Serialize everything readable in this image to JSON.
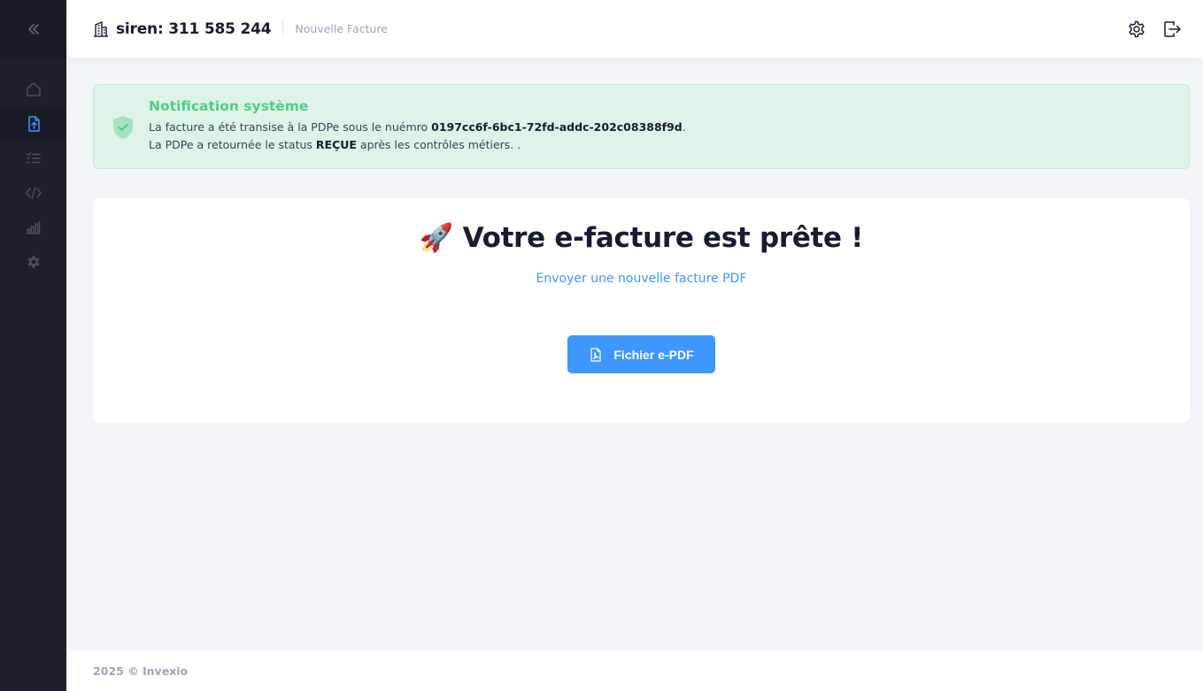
{
  "header": {
    "title": "siren: 311 585 244",
    "subtitle": "Nouvelle Facture"
  },
  "alert": {
    "title": "Notification système",
    "line1_prefix": "La facture a été transise à la PDPe sous le nuémro ",
    "line1_id": "0197cc6f-6bc1-72fd-addc-202c08388f9d",
    "line1_suffix": ".",
    "line2_prefix": "La PDPe a retournée le status ",
    "line2_status": "REÇUE",
    "line2_suffix": " après les contrôles métiers. ."
  },
  "card": {
    "title": "🚀 Votre e-facture est prête !",
    "link": "Envoyer une nouvelle facture PDF",
    "button_label": "Fichier e-PDF"
  },
  "footer": {
    "text": "2025 © Invexio"
  },
  "colors": {
    "sidebar": "#1e1e2d",
    "primary": "#3e97ff",
    "success": "#50cd89",
    "success_bg": "#dff4e8"
  },
  "icons": {
    "sidebar": [
      "double-chevron-left-icon",
      "home-icon",
      "file-upload-icon",
      "list-check-icon",
      "code-icon",
      "bar-chart-icon",
      "gear-icon"
    ],
    "header": [
      "building-icon",
      "settings-icon",
      "logout-icon"
    ],
    "alert": "shield-check-icon",
    "button": "file-pdf-icon"
  }
}
